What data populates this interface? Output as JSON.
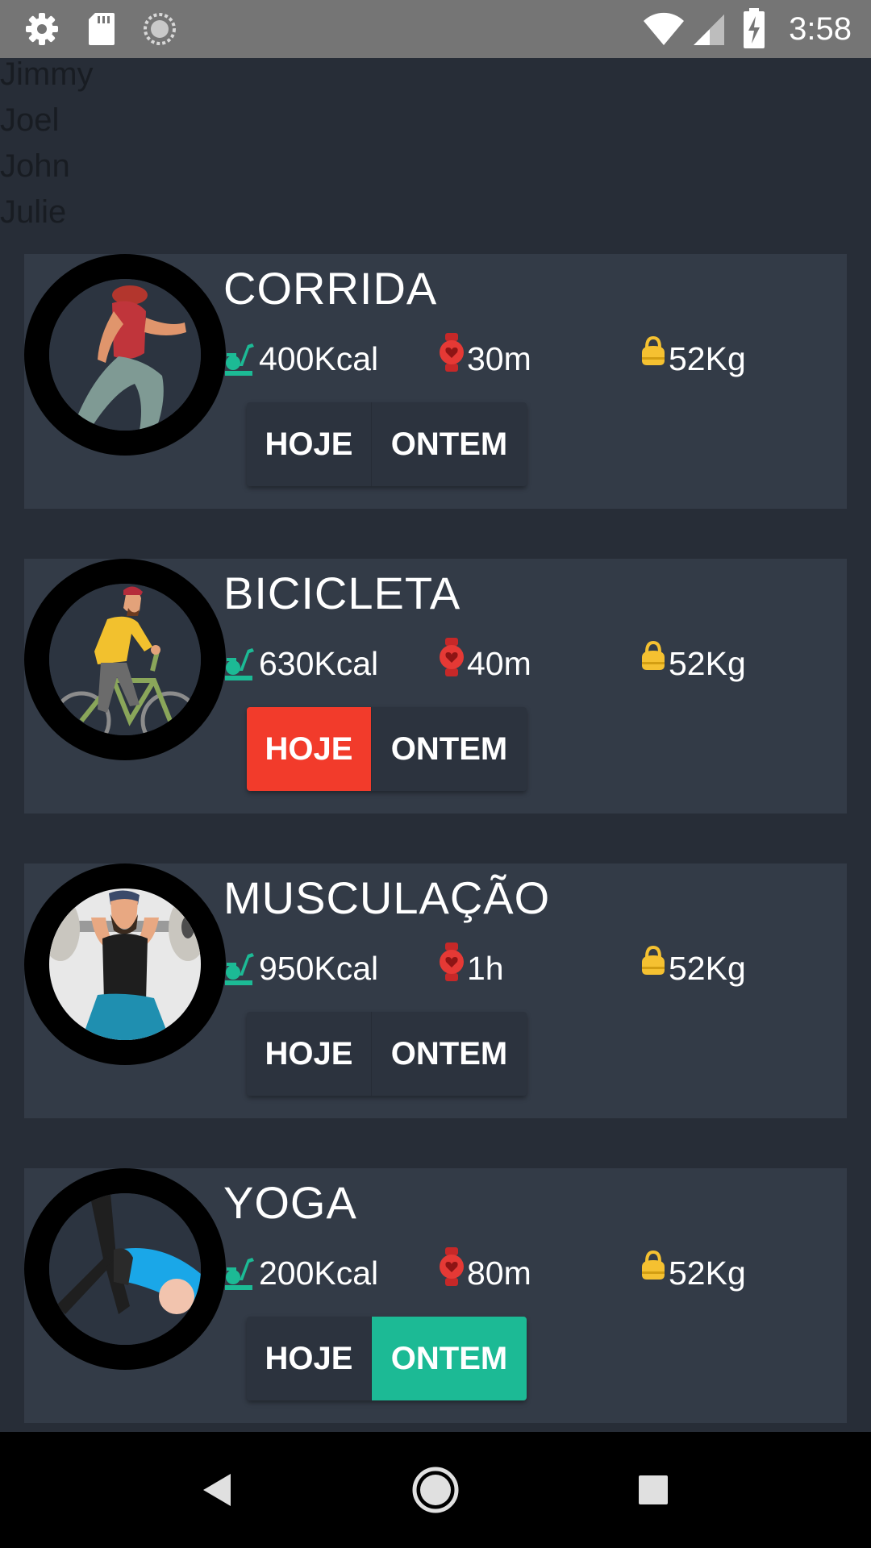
{
  "status_bar": {
    "time": "3:58",
    "left_icons": [
      "settings-icon",
      "sd-card-icon",
      "sync-spinner-icon"
    ],
    "right_icons": [
      "wifi-icon",
      "cell-signal-icon",
      "battery-charging-icon"
    ]
  },
  "names_list": [
    "Jimmy",
    "Joel",
    "John",
    "Julie"
  ],
  "activities": [
    {
      "title": "CORRIDA",
      "kcal": "400Kcal",
      "time": "30m",
      "weight": "52Kg",
      "hoje_label": "HOJE",
      "ontem_label": "ONTEM",
      "selected": "none",
      "image": "runner-illustration"
    },
    {
      "title": "BICICLETA",
      "kcal": "630Kcal",
      "time": "40m",
      "weight": "52Kg",
      "hoje_label": "HOJE",
      "ontem_label": "ONTEM",
      "selected": "hoje",
      "image": "cyclist-illustration"
    },
    {
      "title": "MUSCULAÇÃO",
      "kcal": "950Kcal",
      "time": "1h",
      "weight": "52Kg",
      "hoje_label": "HOJE",
      "ontem_label": "ONTEM",
      "selected": "none",
      "image": "weightlifter-illustration"
    },
    {
      "title": "YOGA",
      "kcal": "200Kcal",
      "time": "80m",
      "weight": "52Kg",
      "hoje_label": "HOJE",
      "ontem_label": "ONTEM",
      "selected": "ontem",
      "image": "yoga-illustration"
    }
  ],
  "icons": {
    "kcal": "exercise-bike-icon",
    "time": "heart-watch-icon",
    "weight": "kettlebell-icon"
  },
  "colors": {
    "background": "#272d37",
    "card": "#333b47",
    "hoje_selected": "#f23b2b",
    "ontem_selected": "#1cba95",
    "kcal_icon": "#1cba95",
    "time_icon": "#e53935",
    "weight_icon": "#f5c131"
  },
  "nav_bar": {
    "buttons": [
      "back-icon",
      "home-icon",
      "recents-icon"
    ]
  }
}
